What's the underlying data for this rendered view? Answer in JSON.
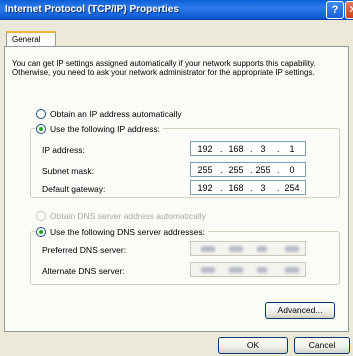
{
  "window": {
    "title": "Internet Protocol (TCP/IP) Properties",
    "help_label": "?",
    "close_label": "✕"
  },
  "tabs": [
    {
      "label": "General"
    }
  ],
  "intro_text": "You can get IP settings assigned automatically if your network supports this capability. Otherwise, you need to ask your network administrator for the appropriate IP settings.",
  "ip_mode": {
    "auto_label": "Obtain an IP address automatically",
    "manual_label": "Use the following IP address:",
    "selected": "manual"
  },
  "ip_fields": {
    "ip_label": "IP address:",
    "ip_value": [
      "192",
      "168",
      "3",
      "1"
    ],
    "mask_label": "Subnet mask:",
    "mask_value": [
      "255",
      "255",
      "255",
      "0"
    ],
    "gateway_label": "Default gateway:",
    "gateway_value": [
      "192",
      "168",
      "3",
      "254"
    ]
  },
  "dns_mode": {
    "auto_label": "Obtain DNS server address automatically",
    "manual_label": "Use the following DNS server addresses:",
    "selected": "manual"
  },
  "dns_fields": {
    "preferred_label": "Preferred DNS server:",
    "alternate_label": "Alternate DNS server:"
  },
  "buttons": {
    "advanced": "Advanced...",
    "ok": "OK",
    "cancel": "Cancel"
  }
}
